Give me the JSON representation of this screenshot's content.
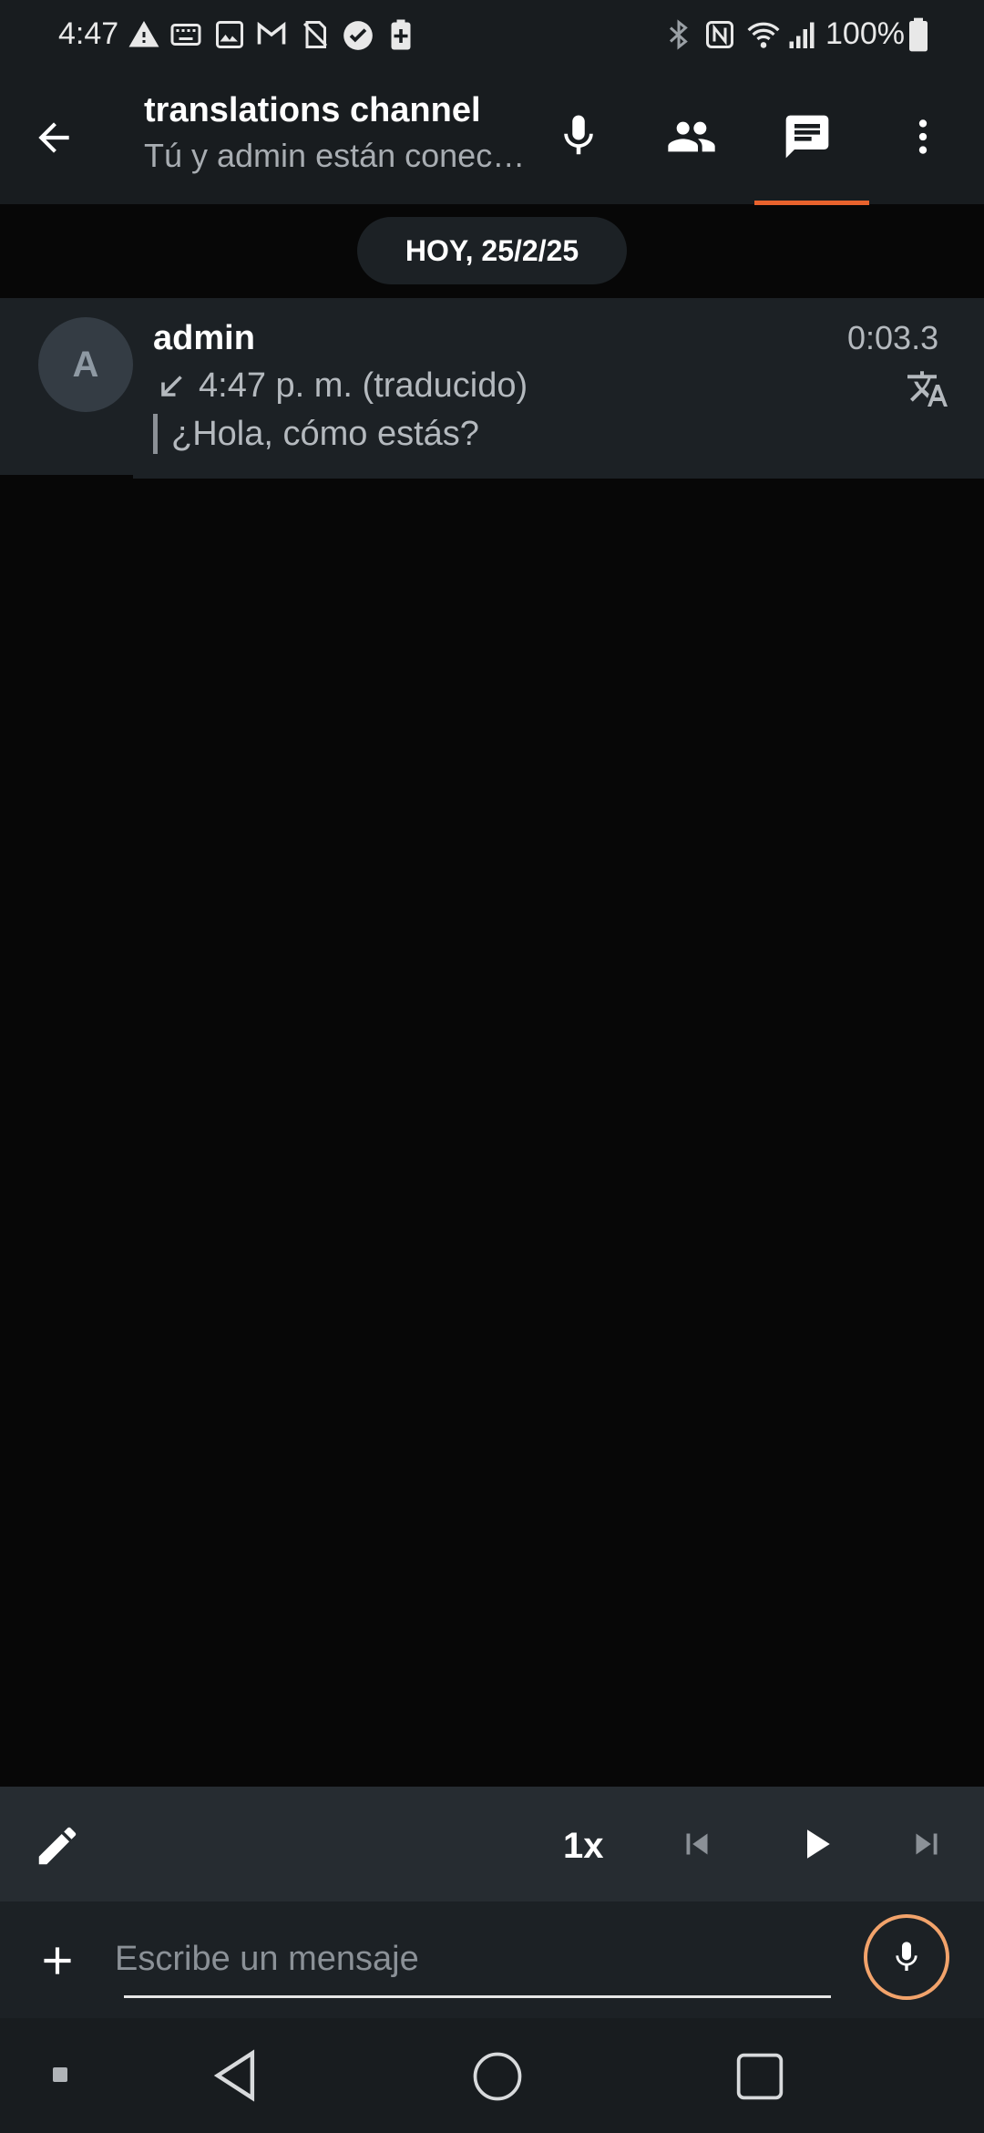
{
  "status_bar": {
    "time": "4:47",
    "battery": "100%",
    "left_icons": [
      "warning-icon",
      "keyboard-icon",
      "image-icon",
      "gmail-icon",
      "no-sim-icon",
      "check-circle-icon",
      "battery-plus-icon"
    ],
    "right_icons": [
      "bluetooth-icon",
      "nfc-icon",
      "wifi-icon",
      "signal-icon",
      "battery-icon"
    ]
  },
  "header": {
    "title": "translations channel",
    "subtitle": "Tú y admin están conectados"
  },
  "date_chip": "HOY, 25/2/25",
  "message": {
    "avatar_initial": "A",
    "sender": "admin",
    "time": "4:47 p. m. (traducido)",
    "text": "¿Hola, cómo estás?",
    "duration": "0:03.3"
  },
  "player": {
    "speed": "1x"
  },
  "composer": {
    "placeholder": "Escribe un mensaje"
  },
  "colors": {
    "accent": "#e8622d",
    "mic_ring": "#f2a36b",
    "bar_bg": "#181c1f",
    "surface": "#1c2125"
  }
}
